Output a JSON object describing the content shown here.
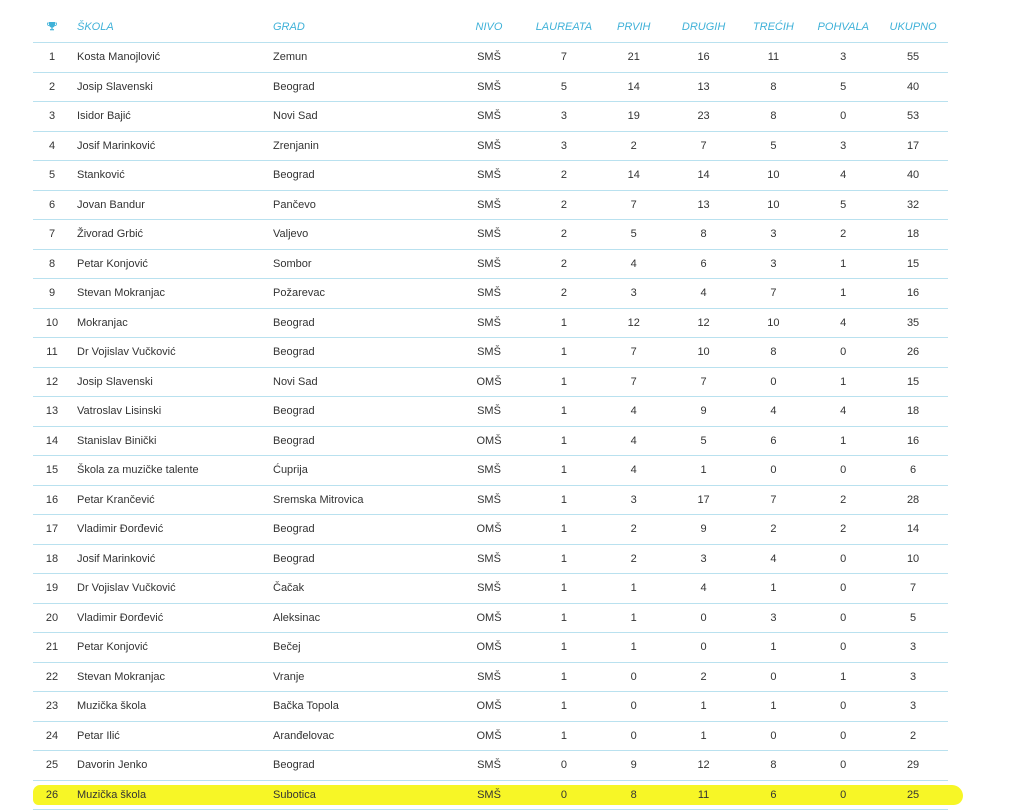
{
  "headers": {
    "skola": "ŠKOLA",
    "grad": "GRAD",
    "nivo": "NIVO",
    "laureata": "LAUREATA",
    "prvih": "PRVIH",
    "drugih": "DRUGIH",
    "trecih": "TREĆIH",
    "pohvala": "POHVALA",
    "ukupno": "UKUPNO"
  },
  "rows": [
    {
      "rank": "1",
      "skola": "Kosta Manojlović",
      "grad": "Zemun",
      "nivo": "SMŠ",
      "laureata": "7",
      "prvih": "21",
      "drugih": "16",
      "trecih": "11",
      "pohvala": "3",
      "ukupno": "55"
    },
    {
      "rank": "2",
      "skola": "Josip Slavenski",
      "grad": "Beograd",
      "nivo": "SMŠ",
      "laureata": "5",
      "prvih": "14",
      "drugih": "13",
      "trecih": "8",
      "pohvala": "5",
      "ukupno": "40"
    },
    {
      "rank": "3",
      "skola": "Isidor Bajić",
      "grad": "Novi Sad",
      "nivo": "SMŠ",
      "laureata": "3",
      "prvih": "19",
      "drugih": "23",
      "trecih": "8",
      "pohvala": "0",
      "ukupno": "53"
    },
    {
      "rank": "4",
      "skola": "Josif Marinković",
      "grad": "Zrenjanin",
      "nivo": "SMŠ",
      "laureata": "3",
      "prvih": "2",
      "drugih": "7",
      "trecih": "5",
      "pohvala": "3",
      "ukupno": "17"
    },
    {
      "rank": "5",
      "skola": "Stanković",
      "grad": "Beograd",
      "nivo": "SMŠ",
      "laureata": "2",
      "prvih": "14",
      "drugih": "14",
      "trecih": "10",
      "pohvala": "4",
      "ukupno": "40"
    },
    {
      "rank": "6",
      "skola": "Jovan Bandur",
      "grad": "Pančevo",
      "nivo": "SMŠ",
      "laureata": "2",
      "prvih": "7",
      "drugih": "13",
      "trecih": "10",
      "pohvala": "5",
      "ukupno": "32"
    },
    {
      "rank": "7",
      "skola": "Živorad Grbić",
      "grad": "Valjevo",
      "nivo": "SMŠ",
      "laureata": "2",
      "prvih": "5",
      "drugih": "8",
      "trecih": "3",
      "pohvala": "2",
      "ukupno": "18"
    },
    {
      "rank": "8",
      "skola": "Petar Konjović",
      "grad": "Sombor",
      "nivo": "SMŠ",
      "laureata": "2",
      "prvih": "4",
      "drugih": "6",
      "trecih": "3",
      "pohvala": "1",
      "ukupno": "15"
    },
    {
      "rank": "9",
      "skola": "Stevan Mokranjac",
      "grad": "Požarevac",
      "nivo": "SMŠ",
      "laureata": "2",
      "prvih": "3",
      "drugih": "4",
      "trecih": "7",
      "pohvala": "1",
      "ukupno": "16"
    },
    {
      "rank": "10",
      "skola": "Mokranjac",
      "grad": "Beograd",
      "nivo": "SMŠ",
      "laureata": "1",
      "prvih": "12",
      "drugih": "12",
      "trecih": "10",
      "pohvala": "4",
      "ukupno": "35"
    },
    {
      "rank": "11",
      "skola": "Dr Vojislav Vučković",
      "grad": "Beograd",
      "nivo": "SMŠ",
      "laureata": "1",
      "prvih": "7",
      "drugih": "10",
      "trecih": "8",
      "pohvala": "0",
      "ukupno": "26"
    },
    {
      "rank": "12",
      "skola": "Josip Slavenski",
      "grad": "Novi Sad",
      "nivo": "OMŠ",
      "laureata": "1",
      "prvih": "7",
      "drugih": "7",
      "trecih": "0",
      "pohvala": "1",
      "ukupno": "15"
    },
    {
      "rank": "13",
      "skola": "Vatroslav Lisinski",
      "grad": "Beograd",
      "nivo": "SMŠ",
      "laureata": "1",
      "prvih": "4",
      "drugih": "9",
      "trecih": "4",
      "pohvala": "4",
      "ukupno": "18"
    },
    {
      "rank": "14",
      "skola": "Stanislav Binički",
      "grad": "Beograd",
      "nivo": "OMŠ",
      "laureata": "1",
      "prvih": "4",
      "drugih": "5",
      "trecih": "6",
      "pohvala": "1",
      "ukupno": "16"
    },
    {
      "rank": "15",
      "skola": "Škola za muzičke talente",
      "grad": "Ćuprija",
      "nivo": "SMŠ",
      "laureata": "1",
      "prvih": "4",
      "drugih": "1",
      "trecih": "0",
      "pohvala": "0",
      "ukupno": "6"
    },
    {
      "rank": "16",
      "skola": "Petar Krančević",
      "grad": "Sremska Mitrovica",
      "nivo": "SMŠ",
      "laureata": "1",
      "prvih": "3",
      "drugih": "17",
      "trecih": "7",
      "pohvala": "2",
      "ukupno": "28"
    },
    {
      "rank": "17",
      "skola": "Vladimir Đorđević",
      "grad": "Beograd",
      "nivo": "OMŠ",
      "laureata": "1",
      "prvih": "2",
      "drugih": "9",
      "trecih": "2",
      "pohvala": "2",
      "ukupno": "14"
    },
    {
      "rank": "18",
      "skola": "Josif Marinković",
      "grad": "Beograd",
      "nivo": "SMŠ",
      "laureata": "1",
      "prvih": "2",
      "drugih": "3",
      "trecih": "4",
      "pohvala": "0",
      "ukupno": "10"
    },
    {
      "rank": "19",
      "skola": "Dr Vojislav Vučković",
      "grad": "Čačak",
      "nivo": "SMŠ",
      "laureata": "1",
      "prvih": "1",
      "drugih": "4",
      "trecih": "1",
      "pohvala": "0",
      "ukupno": "7"
    },
    {
      "rank": "20",
      "skola": "Vladimir Đorđević",
      "grad": "Aleksinac",
      "nivo": "OMŠ",
      "laureata": "1",
      "prvih": "1",
      "drugih": "0",
      "trecih": "3",
      "pohvala": "0",
      "ukupno": "5"
    },
    {
      "rank": "21",
      "skola": "Petar Konjović",
      "grad": "Bečej",
      "nivo": "OMŠ",
      "laureata": "1",
      "prvih": "1",
      "drugih": "0",
      "trecih": "1",
      "pohvala": "0",
      "ukupno": "3"
    },
    {
      "rank": "22",
      "skola": "Stevan Mokranjac",
      "grad": "Vranje",
      "nivo": "SMŠ",
      "laureata": "1",
      "prvih": "0",
      "drugih": "2",
      "trecih": "0",
      "pohvala": "1",
      "ukupno": "3"
    },
    {
      "rank": "23",
      "skola": "Muzička škola",
      "grad": "Bačka Topola",
      "nivo": "OMŠ",
      "laureata": "1",
      "prvih": "0",
      "drugih": "1",
      "trecih": "1",
      "pohvala": "0",
      "ukupno": "3"
    },
    {
      "rank": "24",
      "skola": "Petar Ilić",
      "grad": "Aranđelovac",
      "nivo": "OMŠ",
      "laureata": "1",
      "prvih": "0",
      "drugih": "1",
      "trecih": "0",
      "pohvala": "0",
      "ukupno": "2"
    },
    {
      "rank": "25",
      "skola": "Davorin Jenko",
      "grad": "Beograd",
      "nivo": "SMŠ",
      "laureata": "0",
      "prvih": "9",
      "drugih": "12",
      "trecih": "8",
      "pohvala": "0",
      "ukupno": "29"
    },
    {
      "rank": "26",
      "skola": "Muzička škola",
      "grad": "Subotica",
      "nivo": "SMŠ",
      "laureata": "0",
      "prvih": "8",
      "drugih": "11",
      "trecih": "6",
      "pohvala": "0",
      "ukupno": "25"
    }
  ],
  "highlight_row_index": 25,
  "colors": {
    "header_text": "#3fb1d8",
    "row_border": "#b9e1ef",
    "cell_text": "#333333",
    "highlight": "#f7f51a"
  },
  "icons": {
    "rank_header": "trophy-icon"
  }
}
